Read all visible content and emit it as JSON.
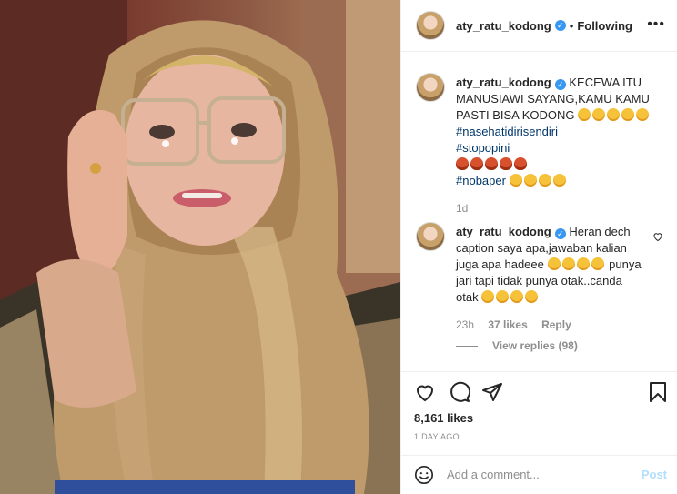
{
  "post": {
    "header": {
      "username": "aty_ratu_kodong",
      "separator": "•",
      "follow_status": "Following",
      "more_label": "•••"
    },
    "caption": {
      "username": "aty_ratu_kodong",
      "text": "KECEWA ITU MANUSIAWI SAYANG,KAMU KAMU PASTI BISA KODONG",
      "hashtags": [
        "#nasehatidirisendiri",
        "#stopopini",
        "#nobaper"
      ],
      "age": "1d"
    },
    "comment": {
      "username": "aty_ratu_kodong",
      "text_line1": "Heran dech caption saya apa,jawaban kalian juga apa hadeee",
      "text_line2": "punya jari tapi tidak punya otak..canda otak",
      "age": "23h",
      "likes": "37 likes",
      "reply_label": "Reply",
      "view_replies": "View replies (98)"
    },
    "likes_count": "8,161 likes",
    "time_ago": "1 DAY AGO",
    "add_comment": {
      "placeholder": "Add a comment...",
      "post_label": "Post"
    }
  }
}
